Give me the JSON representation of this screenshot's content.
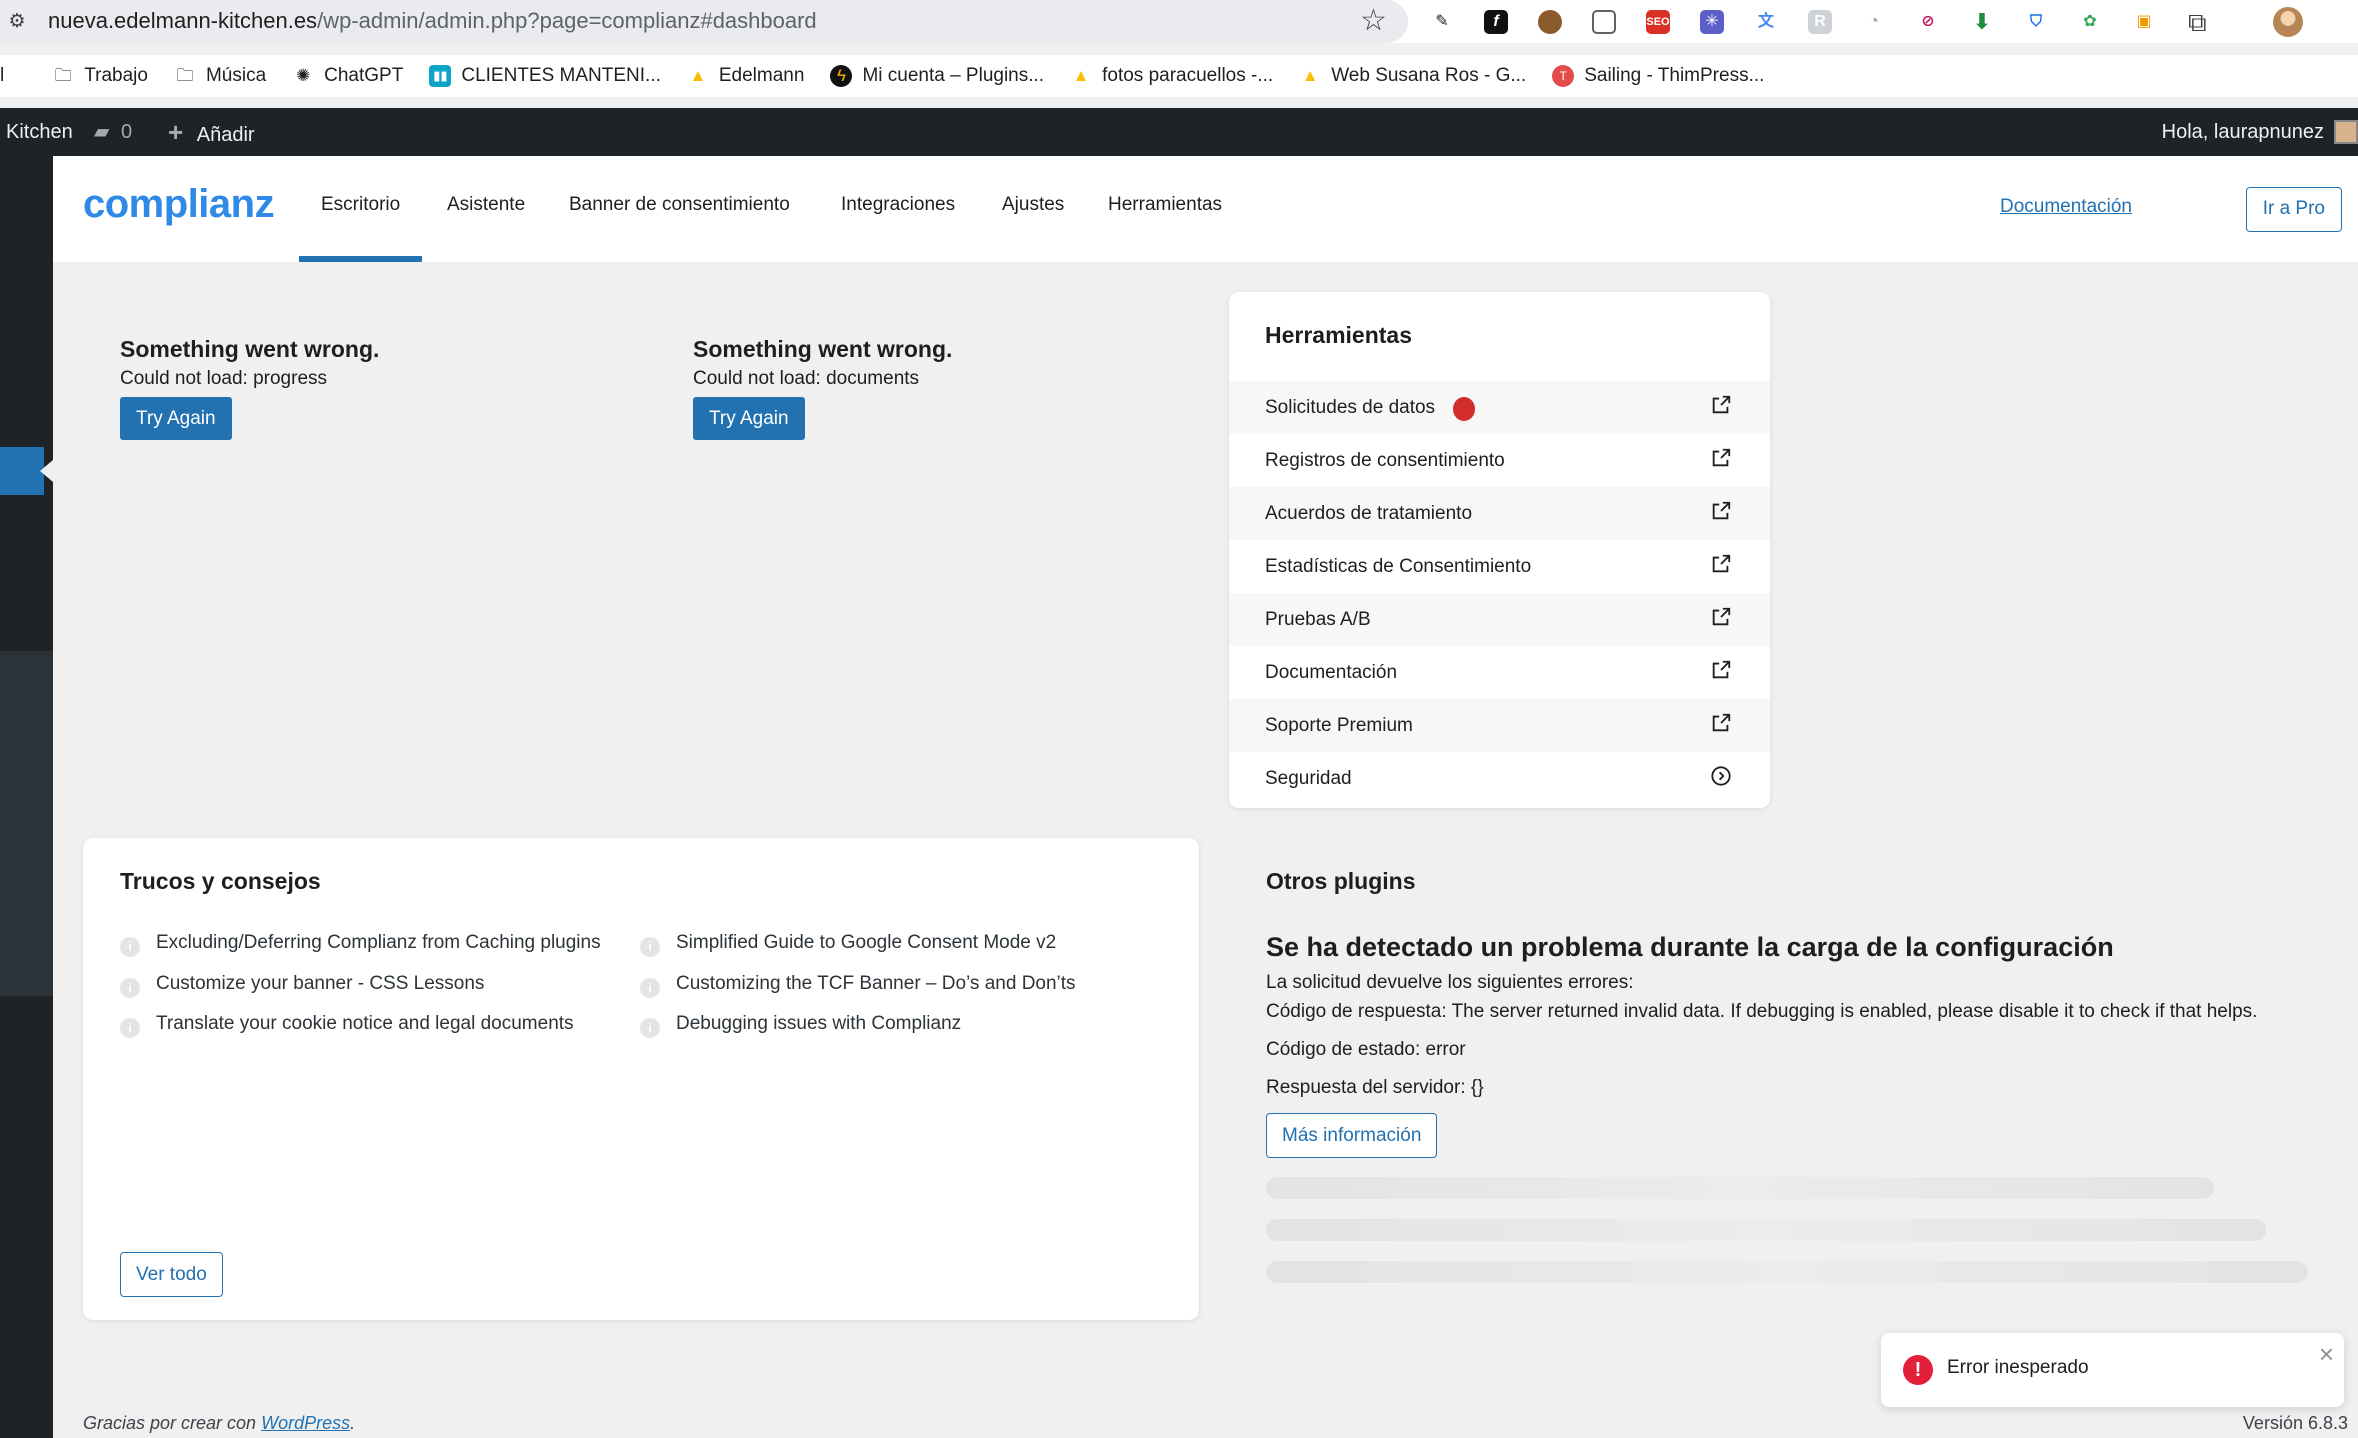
{
  "browser": {
    "url_host": "nueva.edelmann-kitchen.es",
    "url_path": "/wp-admin/admin.php?page=complianz#dashboard",
    "bookmarks": [
      {
        "icon": "folder-icon",
        "label": "Trabajo"
      },
      {
        "icon": "folder-icon",
        "label": "Música"
      },
      {
        "icon": "chatgpt-icon",
        "label": "ChatGPT"
      },
      {
        "icon": "trello-icon",
        "label": "CLIENTES MANTENI..."
      },
      {
        "icon": "google-drive-icon",
        "label": "Edelmann"
      },
      {
        "icon": "lightning-icon",
        "label": "Mi cuenta – Plugins..."
      },
      {
        "icon": "google-drive-icon",
        "label": "fotos paracuellos -..."
      },
      {
        "icon": "google-drive-icon",
        "label": "Web Susana Ros - G..."
      },
      {
        "icon": "thimpress-icon",
        "label": "Sailing - ThimPress..."
      }
    ]
  },
  "adminbar": {
    "site_name": "Kitchen",
    "comments_count": "0",
    "add_new": "Añadir",
    "greeting": "Hola, laurapnunez"
  },
  "header": {
    "logo": "complianz",
    "tabs": [
      {
        "label": "Escritorio",
        "active": true
      },
      {
        "label": "Asistente",
        "active": false
      },
      {
        "label": "Banner de consentimiento",
        "active": false
      },
      {
        "label": "Integraciones",
        "active": false
      },
      {
        "label": "Ajustes",
        "active": false
      },
      {
        "label": "Herramientas",
        "active": false
      }
    ],
    "documentation": "Documentación",
    "go_pro": "Ir a Pro"
  },
  "errors": [
    {
      "title": "Something went wrong.",
      "message": "Could not load: progress",
      "button": "Try Again"
    },
    {
      "title": "Something went wrong.",
      "message": "Could not load: documents",
      "button": "Try Again"
    }
  ],
  "tools": {
    "title": "Herramientas",
    "items": [
      {
        "label": "Solicitudes de datos",
        "icon": "external-link-icon",
        "badge": true
      },
      {
        "label": "Registros de consentimiento",
        "icon": "external-link-icon"
      },
      {
        "label": "Acuerdos de tratamiento",
        "icon": "external-link-icon"
      },
      {
        "label": "Estadísticas de Consentimiento",
        "icon": "external-link-icon"
      },
      {
        "label": "Pruebas A/B",
        "icon": "external-link-icon"
      },
      {
        "label": "Documentación",
        "icon": "external-link-icon"
      },
      {
        "label": "Soporte Premium",
        "icon": "external-link-icon"
      },
      {
        "label": "Seguridad",
        "icon": "circle-arrow-right-icon"
      }
    ]
  },
  "tips": {
    "title": "Trucos y consejos",
    "items": [
      "Excluding/Deferring Complianz from Caching plugins",
      "Customize your banner - CSS Lessons",
      "Translate your cookie notice and legal documents",
      "Simplified Guide to Google Consent Mode v2",
      "Customizing the TCF Banner – Do’s and Don’ts",
      "Debugging issues with Complianz"
    ],
    "see_all": "Ver todo"
  },
  "other_plugins": {
    "title": "Otros plugins",
    "error_title": "Se ha detectado un problema durante la carga de la configuración",
    "intro": "La solicitud devuelve los siguientes errores:",
    "response_code": "Código de respuesta: The server returned invalid data. If debugging is enabled, please disable it to check if that helps.",
    "status_code": "Código de estado: error",
    "server_response": "Respuesta del servidor: {}",
    "more_info": "Más información"
  },
  "toast": {
    "message": "Error inesperado"
  },
  "footer": {
    "thanks_prefix": "Gracias por crear con",
    "thanks_link": "WordPress",
    "thanks_suffix": ".",
    "version": "Versión 6.8.3"
  },
  "colors": {
    "accent": "#2271b1",
    "brand": "#2e8ae6",
    "adminbar": "#1d2327",
    "error": "#e3203a",
    "badge": "#d22c2c"
  }
}
